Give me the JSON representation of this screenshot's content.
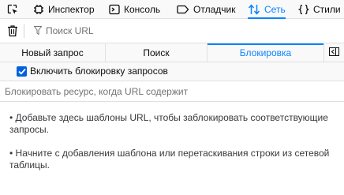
{
  "toolbar": {
    "tools": [
      {
        "label": "",
        "icon": "element-picker-icon"
      },
      {
        "label": "Инспектор",
        "icon": "inspector-icon"
      },
      {
        "label": "Консоль",
        "icon": "console-icon"
      },
      {
        "label": "Отладчик",
        "icon": "debugger-icon"
      },
      {
        "label": "Сеть",
        "icon": "network-icon",
        "selected": true
      },
      {
        "label": "Стили",
        "icon": "style-editor-icon"
      }
    ]
  },
  "filter": {
    "placeholder": "Поиск URL"
  },
  "panel_tabs": [
    {
      "label": "Новый запрос"
    },
    {
      "label": "Поиск"
    },
    {
      "label": "Блокировка",
      "selected": true
    }
  ],
  "blocking": {
    "enable_label": "Включить блокировку запросов",
    "enabled": true,
    "pattern_placeholder": "Блокировать ресурс, когда URL содержит",
    "hints": [
      "• Добавьте здесь шаблоны URL, чтобы заблокировать соответствующие запросы.",
      "• Начните с добавления шаблона или перетаскивания строки из сетевой таблицы."
    ]
  },
  "colors": {
    "accent": "#0a84ff",
    "checkbox": "#0060df",
    "toolbar_bg": "#f9f9fa",
    "border": "#e0e0e2"
  }
}
